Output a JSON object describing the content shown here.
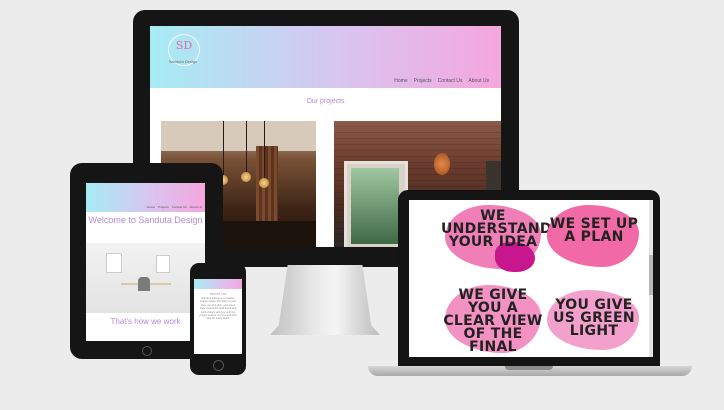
{
  "desktop": {
    "logo": "SD",
    "logo_sub": "Sanduta Design",
    "nav": [
      "Home",
      "Projects",
      "Contact Us",
      "About Us"
    ],
    "section_title": "Our projects"
  },
  "laptop": {
    "cards": [
      {
        "text": "WE UNDERSTAND YOUR IDEA",
        "color": "#f07fb8"
      },
      {
        "text": "WE SET UP A PLAN",
        "color": "#f16aa6"
      },
      {
        "text": "WE GIVE YOU A CLEAR VIEW OF THE FINAL",
        "color": "#f291c2"
      },
      {
        "text": "YOU GIVE US GREEN LIGHT",
        "color": "#f4a0cc"
      }
    ]
  },
  "tablet": {
    "nav": [
      "Home",
      "Projects",
      "Contact Us",
      "About Us"
    ],
    "title": "Welcome to Sanduta Design",
    "subtitle": "That's how we work"
  },
  "phone": {
    "title": "About Us",
    "text": "Sanduta Design is a creative interior studio. We listen to your idea, set up a plan, give you a clear view of the final result and work closely with you until the project is done, on time and with care for every detail."
  }
}
